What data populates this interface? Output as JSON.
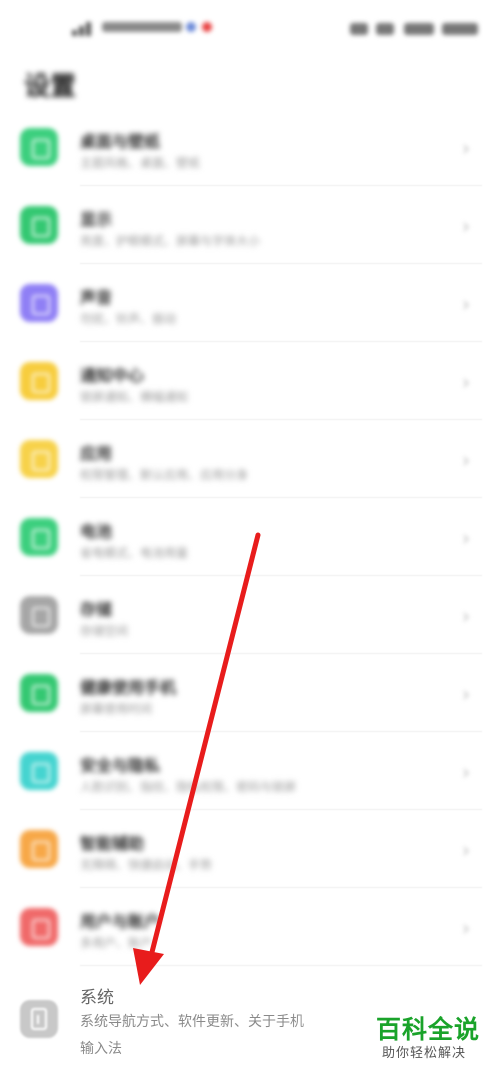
{
  "header": {
    "title": "设置"
  },
  "settings": [
    {
      "title": "桌面与壁纸",
      "subtitle": "主题风格、桌面、壁纸",
      "color": "#3ccf7e"
    },
    {
      "title": "显示",
      "subtitle": "亮度、护眼模式、屏幕与字体大小",
      "color": "#34c872"
    },
    {
      "title": "声音",
      "subtitle": "勿扰、铃声、振动",
      "color": "#8f7ff5"
    },
    {
      "title": "通知中心",
      "subtitle": "锁屏通知、横幅通知",
      "color": "#f7cd3e"
    },
    {
      "title": "应用",
      "subtitle": "权限管理、默认应用、应用分身",
      "color": "#f7d24a"
    },
    {
      "title": "电池",
      "subtitle": "省电模式、电池用量",
      "color": "#3ccf7e"
    },
    {
      "title": "存储",
      "subtitle": "存储空间",
      "color": "#a6a6a6"
    },
    {
      "title": "健康使用手机",
      "subtitle": "屏幕使用时间",
      "color": "#34c872"
    },
    {
      "title": "安全与隐私",
      "subtitle": "人脸识别、指纹、隐私权限、密码与锁屏",
      "color": "#45d4d0"
    },
    {
      "title": "智能辅助",
      "subtitle": "无障碍、快捷启动、手势",
      "color": "#f7a848"
    },
    {
      "title": "用户与账户",
      "subtitle": "多用户、账户",
      "color": "#f06a6a"
    }
  ],
  "system": {
    "title": "系统",
    "subtitle": "系统导航方式、软件更新、关于手机",
    "subtitle2": "输入法"
  },
  "watermark": {
    "title": "百科全说",
    "subtitle": "助你轻松解决"
  },
  "colors": {
    "arrow": "#e81c1c",
    "watermark_green": "#1aa32a"
  }
}
